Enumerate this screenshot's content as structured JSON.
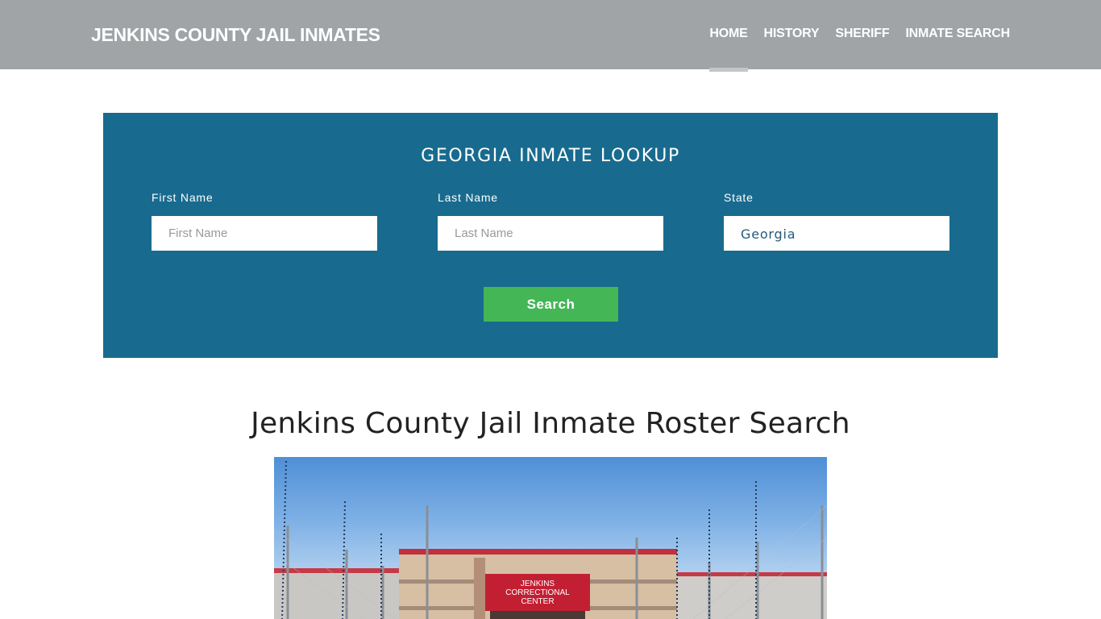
{
  "header": {
    "brand": "JENKINS COUNTY JAIL INMATES",
    "nav": [
      {
        "label": "HOME",
        "active": true
      },
      {
        "label": "HISTORY",
        "active": false
      },
      {
        "label": "SHERIFF",
        "active": false
      },
      {
        "label": "INMATE SEARCH",
        "active": false
      }
    ]
  },
  "lookup": {
    "title": "GEORGIA INMATE LOOKUP",
    "first_name": {
      "label": "First Name",
      "placeholder": "First Name",
      "value": ""
    },
    "last_name": {
      "label": "Last Name",
      "placeholder": "Last Name",
      "value": ""
    },
    "state": {
      "label": "State",
      "value": "Georgia"
    },
    "search_label": "Search"
  },
  "main": {
    "title": "Jenkins County Jail Inmate Roster Search",
    "hero_sign": [
      "JENKINS",
      "CORRECTIONAL",
      "CENTER"
    ]
  },
  "colors": {
    "navbar_bg": "#a0a4a7",
    "lookup_bg": "#186b8e",
    "search_button": "#44b656"
  }
}
